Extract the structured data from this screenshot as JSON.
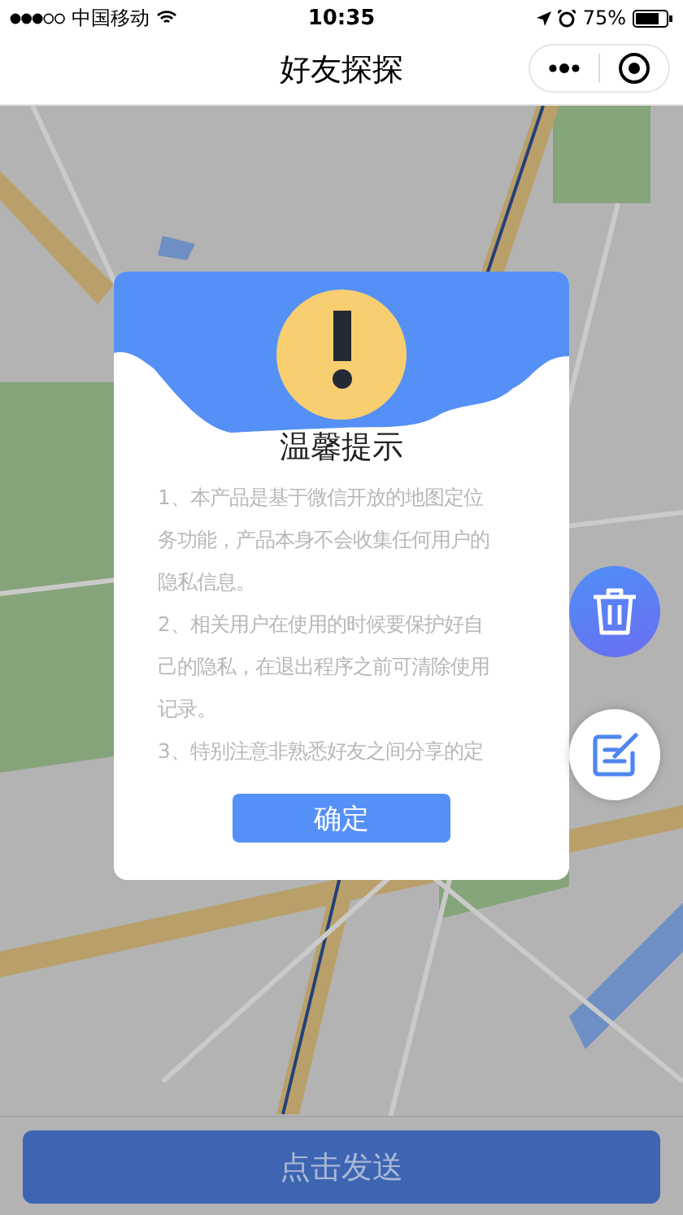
{
  "status_bar": {
    "carrier": "中国移动",
    "time": "10:35",
    "battery": "75%"
  },
  "nav_bar": {
    "title": "好友探探"
  },
  "dialog": {
    "title": "温馨提示",
    "lines": [
      "1、本产品是基于微信开放的地图定位",
      "务功能，产品本身不会收集任何用户的",
      "隐私信息。",
      "2、相关用户在使用的时候要保护好自",
      "己的隐私，在退出程序之前可清除使用",
      "记录。",
      "3、特别注意非熟悉好友之间分享的定"
    ],
    "confirm": "确定"
  },
  "side_buttons": [
    {
      "kind": "delete"
    },
    {
      "kind": "edit"
    }
  ],
  "send_button": "点击发送"
}
